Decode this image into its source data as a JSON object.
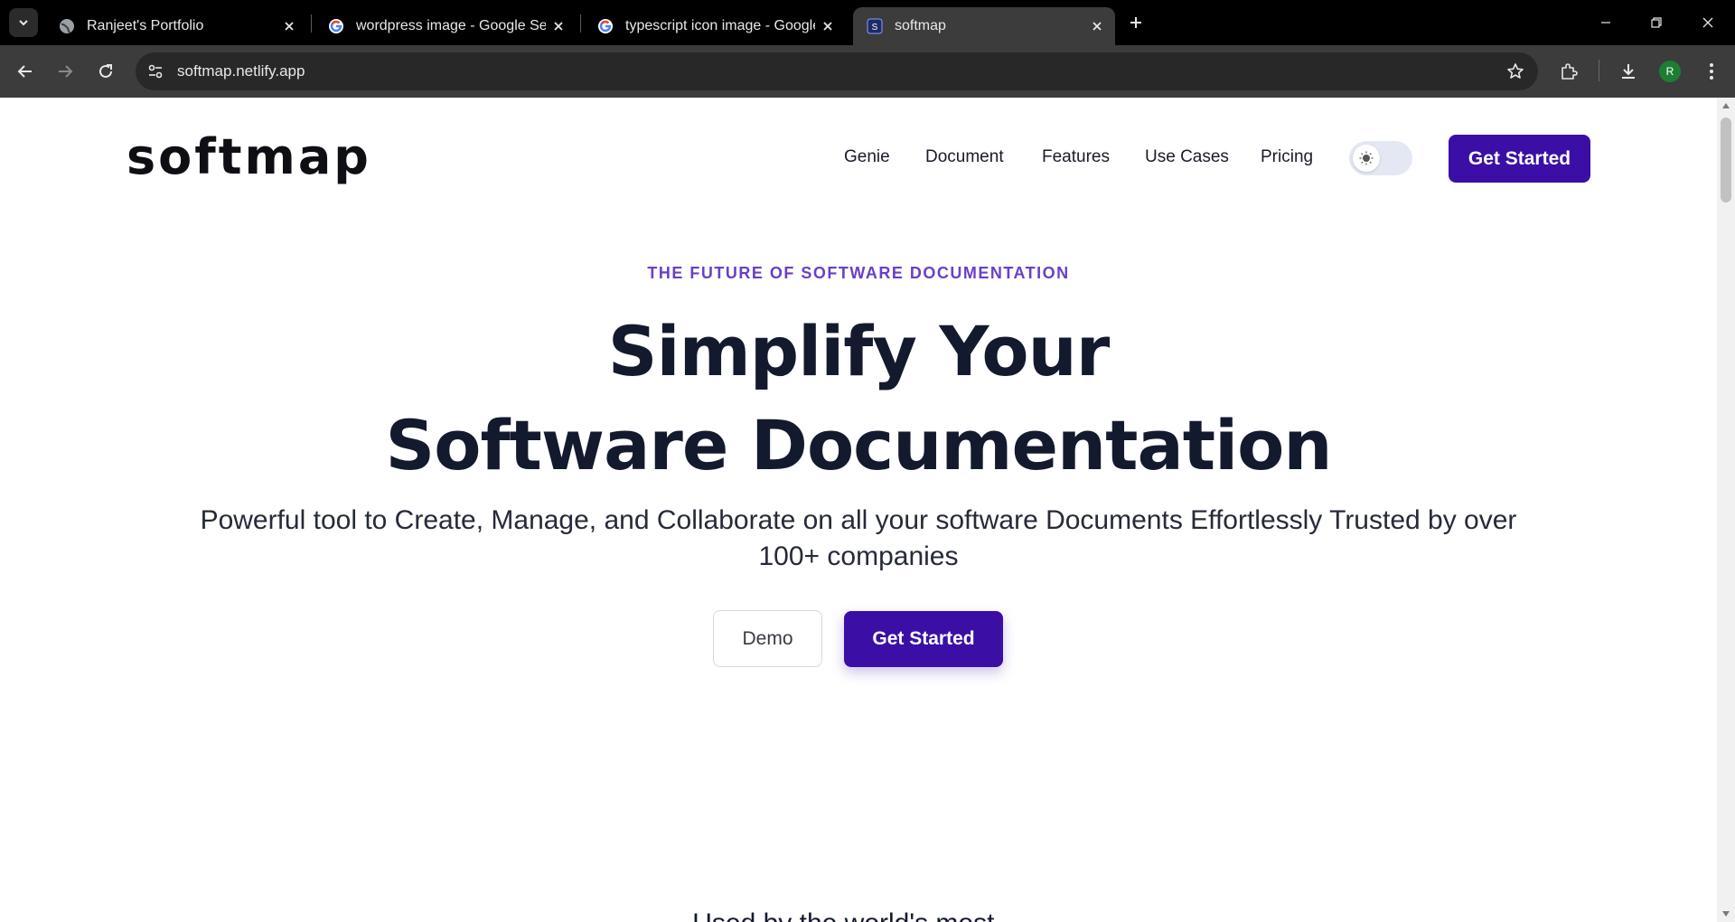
{
  "browser": {
    "tabs": [
      {
        "title": "Ranjeet's Portfolio",
        "favicon": "globe-icon",
        "active": false
      },
      {
        "title": "wordpress image - Google Sear",
        "favicon": "google-icon",
        "active": false
      },
      {
        "title": "typescript icon image - Google",
        "favicon": "google-icon",
        "active": false
      },
      {
        "title": "softmap",
        "favicon": "softmap-favicon",
        "active": true
      }
    ],
    "url": "softmap.netlify.app",
    "profile_initial": "R",
    "colors": {
      "frame": "#000000",
      "toolbar": "#3c3c3c",
      "omnibox": "#282828",
      "avatar": "#1e7d34"
    }
  },
  "site": {
    "logo": "softmap",
    "nav": [
      "Genie",
      "Document",
      "Features",
      "Use Cases",
      "Pricing"
    ],
    "header_cta": "Get Started",
    "theme_toggle_icon": "sun-icon",
    "colors": {
      "primary": "#3b0fa6",
      "eyebrow": "#6a3fc8",
      "heading": "#141a2e"
    }
  },
  "hero": {
    "eyebrow": "THE FUTURE OF SOFTWARE DOCUMENTATION",
    "title_line1": "Simplify Your",
    "title_line2": "Software Documentation",
    "subtitle": "Powerful tool to Create, Manage, and Collaborate on all your software Documents Effortlessly Trusted by over 100+ companies",
    "demo_label": "Demo",
    "cta_label": "Get Started"
  },
  "next_section": {
    "partial_heading": "Used by the world's most ..."
  }
}
